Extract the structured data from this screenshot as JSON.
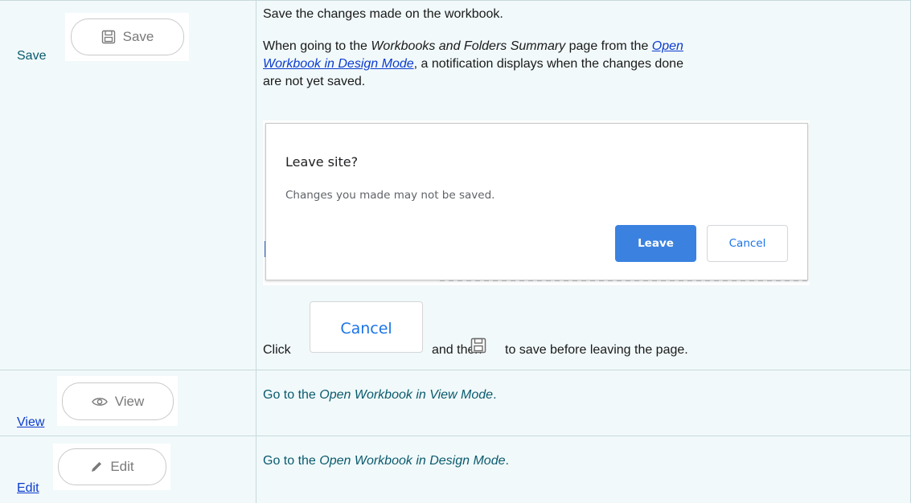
{
  "rows": [
    {
      "term": "Save",
      "term_is_link": false,
      "button_label": "Save",
      "button_icon": "floppy-disk-icon",
      "description": {
        "line1": "Save the changes made on the workbook.",
        "para2_before": "When going to the ",
        "para2_italic": "Workbooks and Folders Summary",
        "para2_mid": " page from the ",
        "para2_link_a": "Open",
        "para2_link_b": "Workbook in Design Mode",
        "para2_after_a": ", a notification displays when the changes done",
        "para2_after_b": "are not yet saved.",
        "click_prefix": "Click",
        "click_middle": "and then",
        "click_suffix": "to save before leaving the page."
      },
      "dialog": {
        "title": "Leave site?",
        "message": "Changes you made may not be saved.",
        "leave_label": "Leave",
        "cancel_label": "Cancel"
      },
      "cancel_button_label": "Cancel"
    },
    {
      "term": "View",
      "term_is_link": true,
      "button_label": "View",
      "button_icon": "eye-icon",
      "description": {
        "before": "Go to the ",
        "italic": "Open Workbook in View Mode",
        "after": "."
      }
    },
    {
      "term": "Edit",
      "term_is_link": true,
      "button_label": "Edit",
      "button_icon": "pencil-icon",
      "description": {
        "before": "Go to the ",
        "italic": "Open Workbook in Design Mode",
        "after": "."
      }
    }
  ],
  "colors": {
    "cell_background": "#f1f9fa",
    "border": "#c8dadd",
    "teal_text": "#0a5a6e",
    "link": "#0b3bcf",
    "dialog_primary": "#3b82e0",
    "dialog_cancel_text": "#1a73e8"
  }
}
